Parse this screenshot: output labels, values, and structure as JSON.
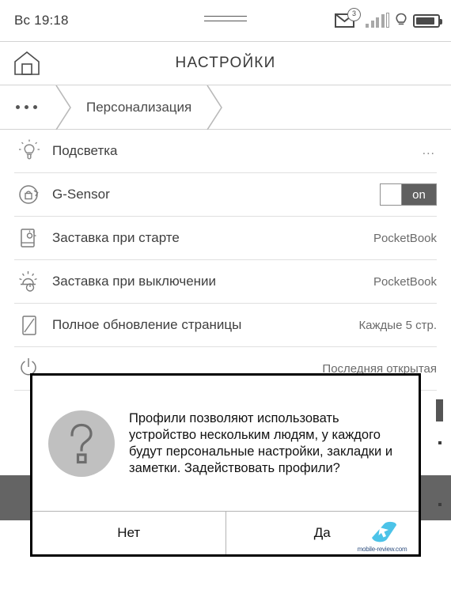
{
  "statusbar": {
    "clock": "Вс 19:18",
    "mail_badge": "3",
    "icons": [
      "mail-icon",
      "signal-icon",
      "frontlight-bulb-icon",
      "battery-icon"
    ]
  },
  "titlebar": {
    "home_icon": "home-icon",
    "title": "НАСТРОЙКИ"
  },
  "breadcrumb": {
    "overflow": "...",
    "current": "Персонализация"
  },
  "settings": {
    "rows": [
      {
        "icon": "lightbulb-icon",
        "label": "Подсветка",
        "value": "...",
        "control": "dots"
      },
      {
        "icon": "rotation-lock-icon",
        "label": "G-Sensor",
        "value": "on",
        "control": "toggle"
      },
      {
        "icon": "startup-logo-icon",
        "label": "Заставка при старте",
        "value": "PocketBook",
        "control": "value"
      },
      {
        "icon": "poweroff-logo-icon",
        "label": "Заставка при выключении",
        "value": "PocketBook",
        "control": "value"
      },
      {
        "icon": "page-refresh-icon",
        "label": "Полное обновление страницы",
        "value": "Каждые 5 стр.",
        "control": "value"
      },
      {
        "icon": "power-icon",
        "label": "",
        "value": "Последняя открытая",
        "control": "value"
      }
    ]
  },
  "dialog": {
    "icon": "question-mark-icon",
    "message": "Профили позволяют использовать устройство нескольким людям, у каждого будут персональные настройки, закладки и заметки. Задействовать профили?",
    "buttons": {
      "no": "Нет",
      "yes": "Да"
    }
  },
  "watermark": {
    "text": "mobile-review.com",
    "logo_color": "#4cc3e8"
  },
  "colors": {
    "toggle_on_bg": "#606060",
    "dark_band": "#646464",
    "question_circle": "#c0c0c0",
    "dialog_border": "#000000"
  }
}
